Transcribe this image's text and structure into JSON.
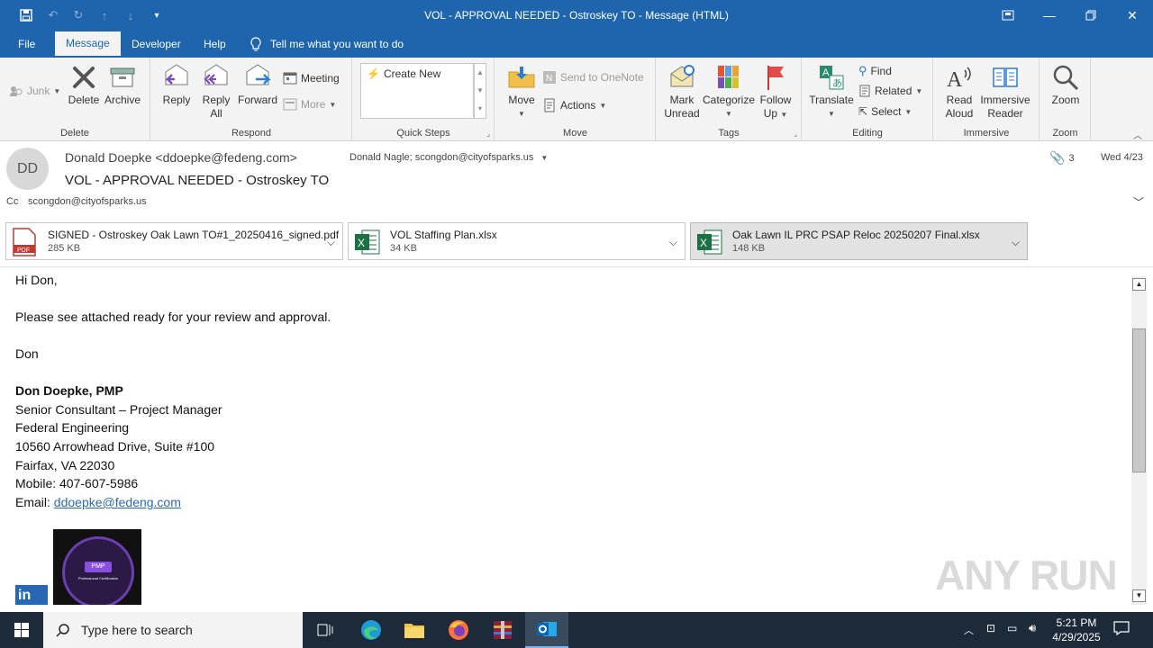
{
  "window": {
    "title": "VOL - APPROVAL NEEDED - Ostroskey TO  -  Message (HTML)"
  },
  "tabs": [
    {
      "label": "File"
    },
    {
      "label": "Message"
    },
    {
      "label": "Developer"
    },
    {
      "label": "Help"
    }
  ],
  "tell_me": "Tell me what you want to do",
  "ribbon": {
    "junk": "Junk",
    "delete": "Delete",
    "archive": "Archive",
    "group_delete": "Delete",
    "reply": "Reply",
    "reply_all_1": "Reply",
    "reply_all_2": "All",
    "forward": "Forward",
    "meeting": "Meeting",
    "more": "More",
    "group_respond": "Respond",
    "create_new": "Create New",
    "group_quick_steps": "Quick Steps",
    "move": "Move",
    "send_onenote": "Send to OneNote",
    "actions": "Actions",
    "group_move": "Move",
    "mark_unread_1": "Mark",
    "mark_unread_2": "Unread",
    "categorize": "Categorize",
    "follow_up_1": "Follow",
    "follow_up_2": "Up",
    "group_tags": "Tags",
    "translate": "Translate",
    "find": "Find",
    "related": "Related",
    "select": "Select",
    "group_editing": "Editing",
    "read_aloud_1": "Read",
    "read_aloud_2": "Aloud",
    "immersive_1": "Immersive",
    "immersive_2": "Reader",
    "group_immersive": "Immersive",
    "zoom": "Zoom",
    "group_zoom": "Zoom"
  },
  "message": {
    "avatar_initials": "DD",
    "from": "Donald Doepke <ddoepke@fedeng.com>",
    "subject": "VOL - APPROVAL NEEDED - Ostroskey TO",
    "to": "Donald Nagle; scongdon@cityofsparks.us",
    "attachment_count": "3",
    "date": "Wed 4/23",
    "cc_label": "Cc",
    "cc": "scongdon@cityofsparks.us"
  },
  "attachments": [
    {
      "name": "SIGNED - Ostroskey Oak Lawn TO#1_20250416_signed.pdf",
      "size": "285 KB",
      "type": "pdf"
    },
    {
      "name": "VOL Staffing Plan.xlsx",
      "size": "34 KB",
      "type": "xlsx"
    },
    {
      "name": "Oak Lawn IL PRC PSAP Reloc 20250207 Final.xlsx",
      "size": "148 KB",
      "type": "xlsx"
    }
  ],
  "body": {
    "greeting": "Hi Don,",
    "para": "Please see attached ready for your review and approval.",
    "signoff": "Don",
    "sig_name": "Don Doepke, PMP",
    "sig_title": "Senior Consultant – Project Manager",
    "sig_company": "Federal Engineering",
    "sig_address": "10560 Arrowhead Drive, Suite #100",
    "sig_city": "Fairfax, VA 22030",
    "sig_mobile": "Mobile: 407-607-5986",
    "sig_email_label": "Email: ",
    "sig_email": "ddoepke@fedeng.com",
    "badge_text": "PMP",
    "badge_sub": "Professional Certification"
  },
  "watermark": "ANY RUN",
  "taskbar": {
    "search_placeholder": "Type here to search",
    "time": "5:21 PM",
    "date": "4/29/2025"
  }
}
